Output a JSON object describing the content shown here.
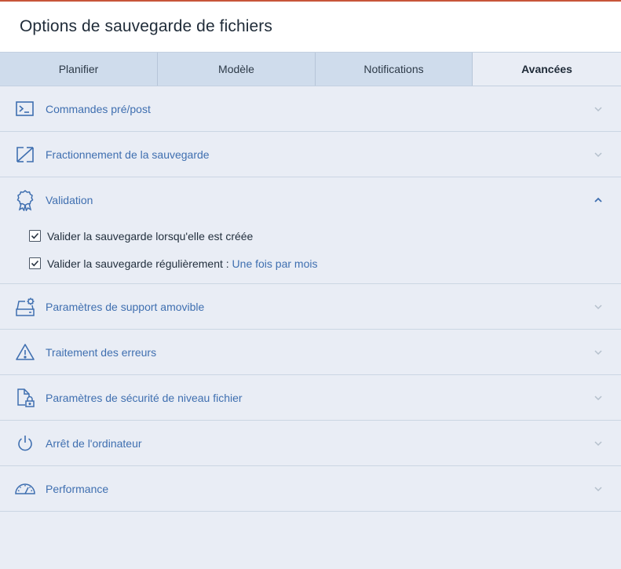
{
  "window": {
    "title": "Options de sauvegarde de fichiers"
  },
  "tabs": [
    {
      "label": "Planifier"
    },
    {
      "label": "Modèle"
    },
    {
      "label": "Notifications"
    },
    {
      "label": "Avancées",
      "active": true
    }
  ],
  "sections": [
    {
      "label": "Commandes pré/post",
      "icon": "terminal-icon",
      "expanded": false
    },
    {
      "label": "Fractionnement de la sauvegarde",
      "icon": "split-icon",
      "expanded": false
    },
    {
      "label": "Validation",
      "icon": "badge-icon",
      "expanded": true
    },
    {
      "label": "Paramètres de support amovible",
      "icon": "removable-drive-icon",
      "expanded": false
    },
    {
      "label": "Traitement des erreurs",
      "icon": "warning-icon",
      "expanded": false
    },
    {
      "label": "Paramètres de sécurité de niveau fichier",
      "icon": "file-lock-icon",
      "expanded": false
    },
    {
      "label": "Arrêt de l'ordinateur",
      "icon": "power-icon",
      "expanded": false
    },
    {
      "label": "Performance",
      "icon": "gauge-icon",
      "expanded": false
    }
  ],
  "validation": {
    "option1": {
      "label": "Valider la sauvegarde lorsqu'elle est créée",
      "checked": true
    },
    "option2": {
      "label": "Valider la sauvegarde régulièrement : ",
      "link": "Une fois par mois",
      "checked": true
    }
  },
  "colors": {
    "accent": "#3f6fb0",
    "top_line": "#c7553a",
    "tab_bar": "#cfdcec",
    "background": "#e9edf5"
  }
}
